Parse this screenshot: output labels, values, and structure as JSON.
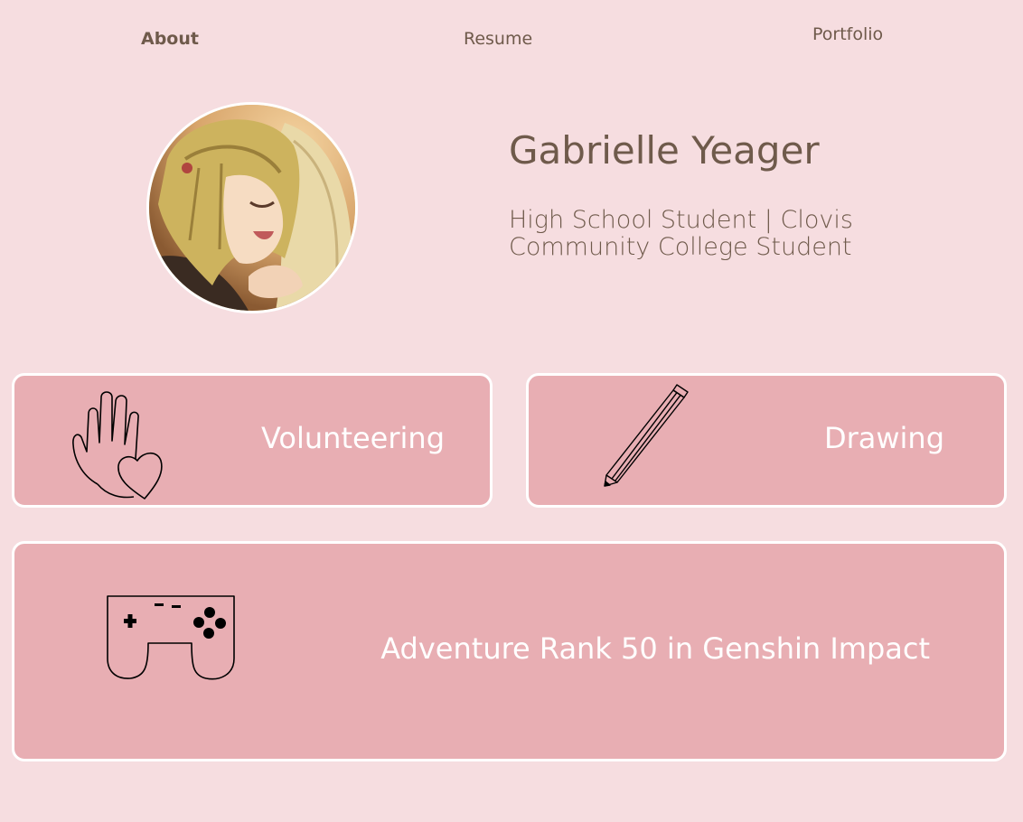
{
  "nav": {
    "about": "About",
    "resume": "Resume",
    "portfolio": "Portfolio"
  },
  "profile": {
    "name": "Gabrielle Yeager",
    "subtitle": "High School Student | Clovis Community College Student",
    "avatar_icon": "profile-photo"
  },
  "cards": {
    "volunteering": {
      "label": "Volunteering",
      "icon": "hand-heart-icon"
    },
    "drawing": {
      "label": "Drawing",
      "icon": "pencil-icon"
    },
    "gaming": {
      "label": "Adventure Rank 50 in Genshin Impact",
      "icon": "game-controller-icon"
    }
  },
  "colors": {
    "background": "#f6dde0",
    "card": "#e8aeb3",
    "card_border": "#ffffff",
    "text": "#6f5a4b",
    "card_text": "#ffffff"
  }
}
